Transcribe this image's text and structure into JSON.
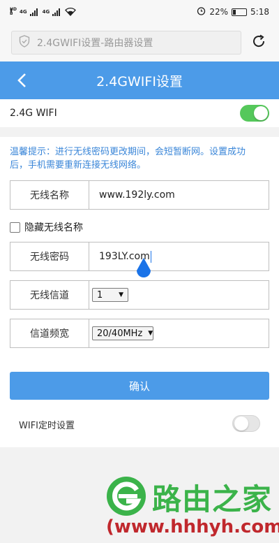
{
  "status_bar": {
    "hd_top": "HD",
    "hd_bottom": "B",
    "sig1": "4G",
    "sig2": "4G",
    "battery": "22%",
    "battery_level": 0.22,
    "time": "5:18",
    "icons": [
      "hd-icon",
      "signal-icon",
      "wifi-icon",
      "alarm-icon",
      "battery-icon"
    ]
  },
  "browser": {
    "url_text": "2.4GWIFI设置-路由器设置",
    "icons": [
      "shield-icon",
      "reload-icon"
    ]
  },
  "header": {
    "title": "2.4GWIFI设置",
    "back_icon": "chevron-left-icon"
  },
  "wifi_toggle": {
    "label": "2.4G WIFI",
    "on": true
  },
  "form": {
    "tip": "温馨提示：进行无线密码更改期间，会短暂断网。设置成功后，手机需要重新连接无线网络。",
    "ssid_label": "无线名称",
    "ssid_value": "www.192ly.com",
    "hide_ssid_label": "隐藏无线名称",
    "hide_ssid_checked": false,
    "password_label": "无线密码",
    "password_value": "193LY.com",
    "channel_label": "无线信道",
    "channel_value": "1",
    "bandwidth_label": "信道频宽",
    "bandwidth_value": "20/40MHz",
    "confirm_label": "确认",
    "schedule_label": "WIFI定时设置",
    "schedule_on": false
  },
  "watermark": {
    "brand": "路由之家",
    "url": "(www.hhhyh.com)"
  },
  "colors": {
    "accent": "#4c9be8",
    "toggle_on": "#55c85b",
    "tip_text": "#3a86d8",
    "brand_green": "#3bb34a",
    "brand_red": "#c0282d"
  }
}
